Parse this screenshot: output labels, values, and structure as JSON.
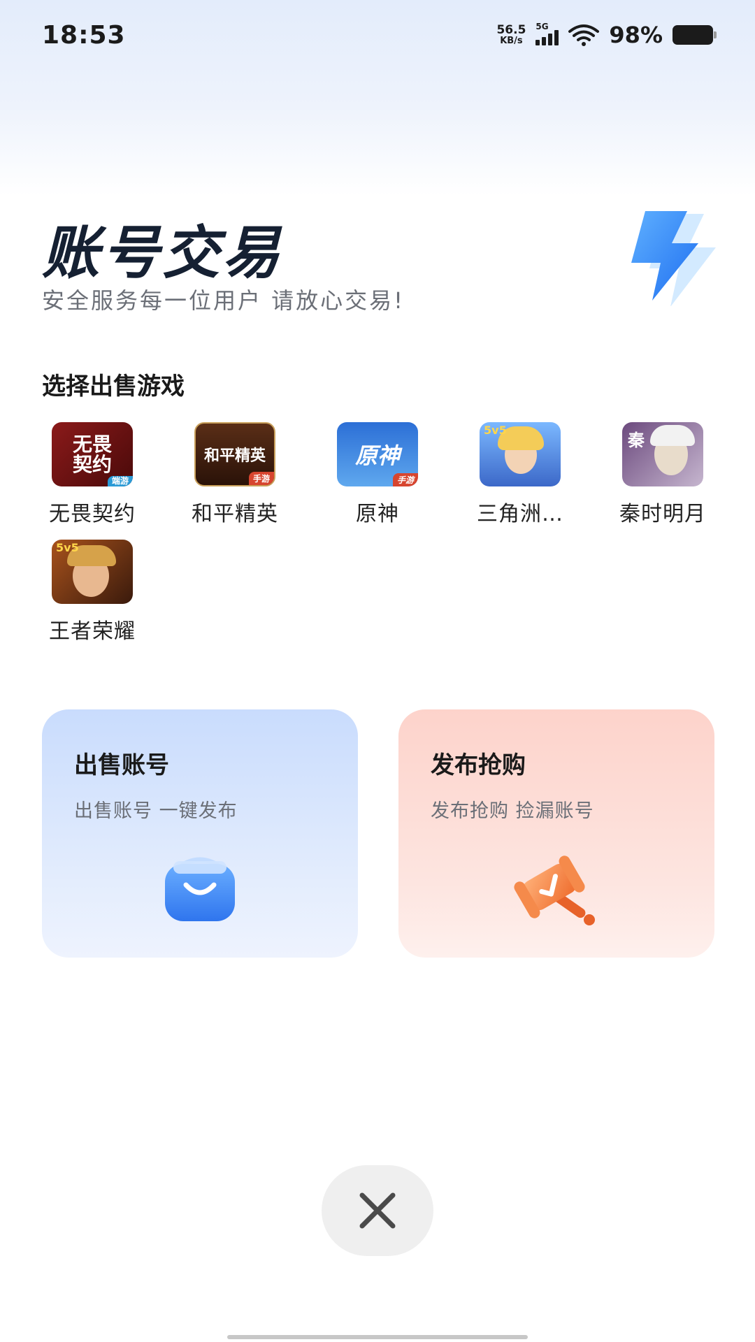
{
  "status_bar": {
    "time": "18:53",
    "net_speed_value": "56.5",
    "net_speed_unit": "KB/s",
    "network_type": "5G",
    "battery_percent": "98%"
  },
  "header": {
    "title": "账号交易",
    "subtitle": "安全服务每一位用户 请放心交易!"
  },
  "games_section": {
    "title": "选择出售游戏",
    "games": [
      {
        "label": "无畏契约",
        "icon": "game-icon-wuwei",
        "tag": "端游",
        "icon_text": "无畏契约"
      },
      {
        "label": "和平精英",
        "icon": "game-icon-heping",
        "tag": "手游",
        "icon_text": "和平精英"
      },
      {
        "label": "原神",
        "icon": "game-icon-yuanshen",
        "tag": "手游",
        "icon_text": "原神"
      },
      {
        "label": "三角洲…",
        "icon": "game-icon-sanjiao",
        "icon_text": "5v5"
      },
      {
        "label": "秦时明月",
        "icon": "game-icon-qinshi",
        "icon_text": "秦"
      },
      {
        "label": "王者荣耀",
        "icon": "game-icon-wangzhe",
        "icon_text": "5v5"
      }
    ]
  },
  "cards": {
    "sell": {
      "title": "出售账号",
      "desc": "出售账号 一键发布",
      "icon": "shopping-bag-icon"
    },
    "buy": {
      "title": "发布抢购",
      "desc": "发布抢购 捡漏账号",
      "icon": "gavel-icon"
    }
  },
  "colors": {
    "sell_card": "#c9dcfd",
    "buy_card": "#fdd3cb",
    "accent_blue": "#3a86f5",
    "accent_orange": "#f2823e"
  }
}
